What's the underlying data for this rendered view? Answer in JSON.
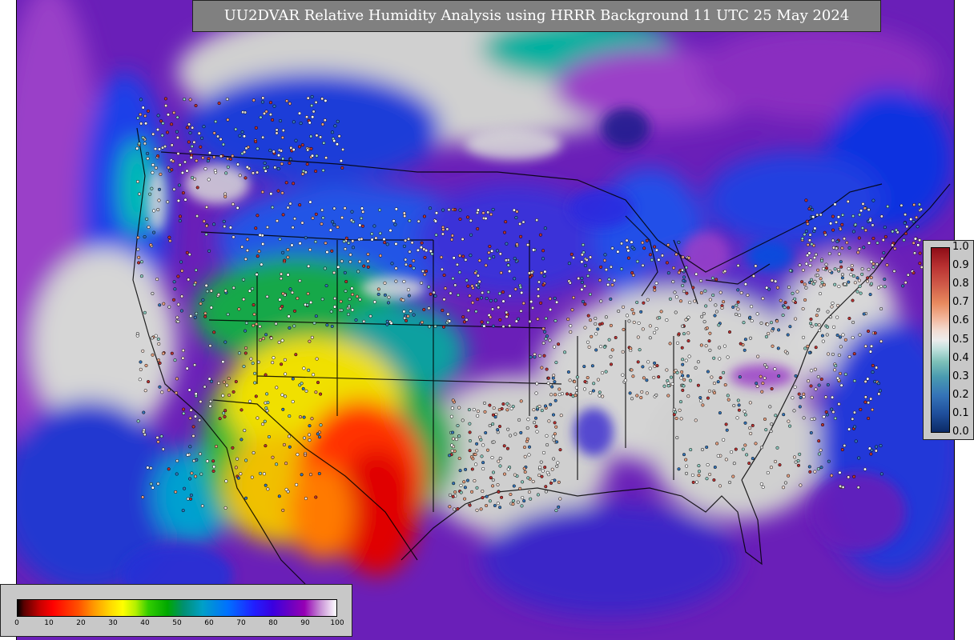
{
  "title": "UU2DVAR Relative Humidity Analysis using HRRR Background 11 UTC 25 May 2024",
  "rh_colorbar": {
    "ticks": [
      "0",
      "10",
      "20",
      "30",
      "40",
      "50",
      "60",
      "70",
      "80",
      "90",
      "100"
    ],
    "range": [
      0,
      100
    ]
  },
  "obs_colorbar": {
    "ticks": [
      "1.0",
      "0.9",
      "0.8",
      "0.7",
      "0.6",
      "0.5",
      "0.4",
      "0.3",
      "0.2",
      "0.1",
      "0.0"
    ],
    "range": [
      0.0,
      1.0
    ]
  },
  "colors": {
    "very_dry": "#c80000",
    "dry": "#ffff00",
    "moderate": "#00a800",
    "moist": "#0070ff",
    "very_moist": "#7000c0",
    "saturated": "#d8d8d8",
    "title_bg": "#808080",
    "legend_bg": "#c8c8c8"
  }
}
